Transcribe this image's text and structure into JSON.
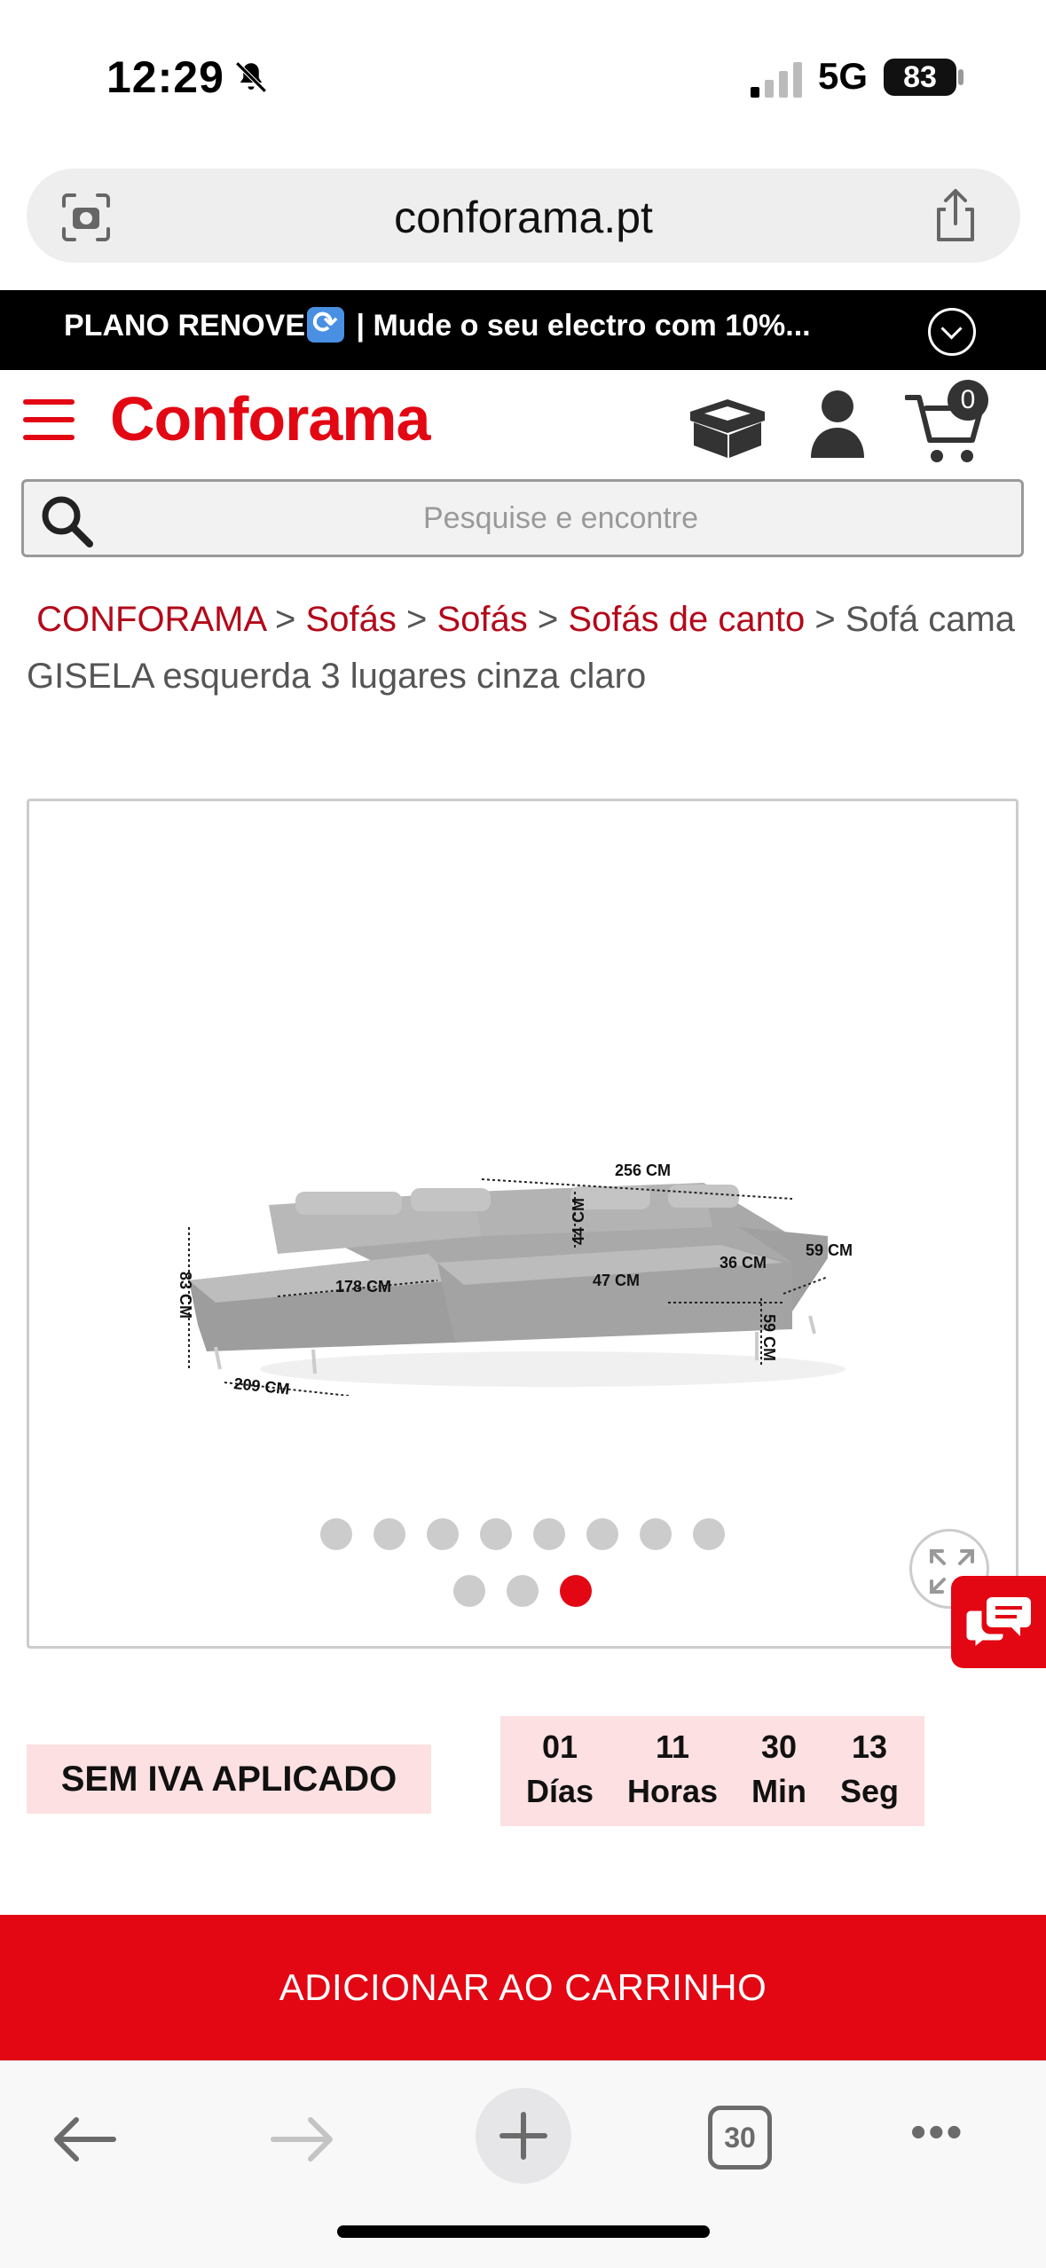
{
  "status_bar": {
    "time": "12:29",
    "network": "5G",
    "battery": "83"
  },
  "browser": {
    "url": "conforama.pt",
    "tab_count": "30"
  },
  "promo": {
    "text_before": "PLANO RENOVE",
    "text_after": " | Mude o seu electro com 10%..."
  },
  "header": {
    "logo": "Conforama",
    "cart_count": "0"
  },
  "search": {
    "placeholder": "Pesquise e encontre"
  },
  "breadcrumb": {
    "items": [
      "CONFORAMA",
      "Sofás",
      "Sofás",
      "Sofás de canto"
    ],
    "current": "Sofá cama GISELA esquerda 3 lugares cinza claro"
  },
  "product_image": {
    "dimensions": {
      "width_total": "256 CM",
      "height": "83 CM",
      "back_height": "44 CM",
      "chaise_length": "178 CM",
      "seat_depth": "47 CM",
      "arm_width": "36 CM",
      "arm_height": "59 CM",
      "side_depth": "59 CM",
      "chaise_width": "209 CM"
    },
    "dots_total": 11,
    "active_dot": 10
  },
  "pricing": {
    "tax_badge": "SEM IVA APLICADO"
  },
  "countdown": [
    {
      "value": "01",
      "label": "Días"
    },
    {
      "value": "11",
      "label": "Horas"
    },
    {
      "value": "30",
      "label": "Min"
    },
    {
      "value": "13",
      "label": "Seg"
    }
  ],
  "cta": {
    "add_to_cart": "ADICIONAR AO CARRINHO"
  },
  "colors": {
    "brand_red": "#e30613",
    "badge_pink": "#fde0e2"
  }
}
